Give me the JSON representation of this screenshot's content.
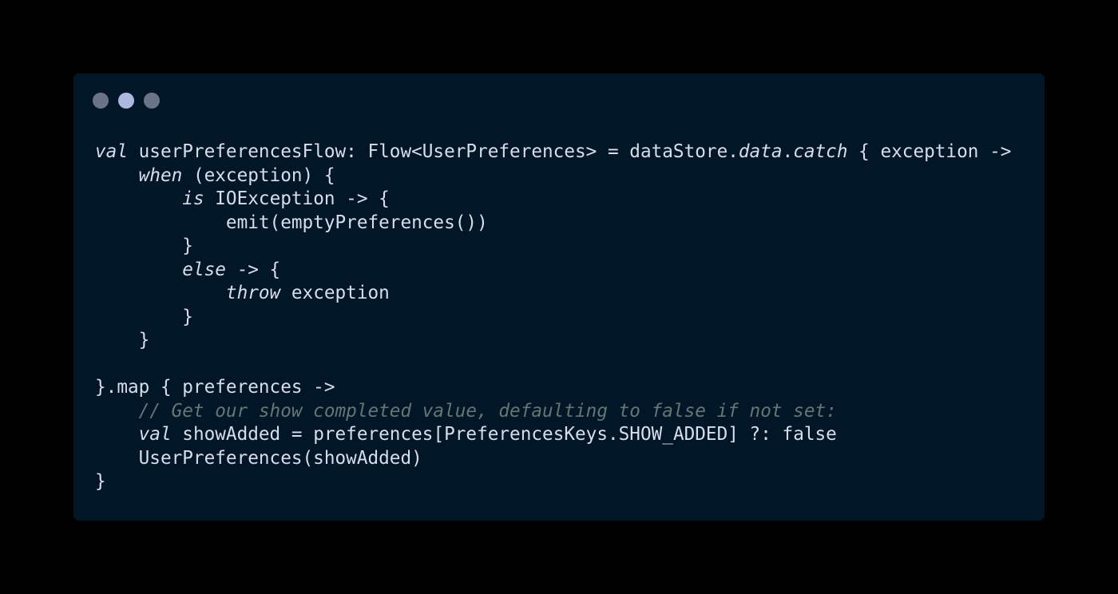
{
  "window": {
    "buttons": [
      {
        "name": "close",
        "color": "#6b7386"
      },
      {
        "name": "minimize",
        "color": "#aeb8de"
      },
      {
        "name": "maximize",
        "color": "#6b7386"
      }
    ]
  },
  "theme": {
    "background": "#011627",
    "text": "#d6deeb",
    "comment": "#637777"
  },
  "code": {
    "lines": [
      [
        {
          "t": "val",
          "s": "kw"
        },
        {
          "t": " userPreferencesFlow: Flow<UserPreferences> = dataStore."
        },
        {
          "t": "data",
          "s": "it"
        },
        {
          "t": "."
        },
        {
          "t": "catch",
          "s": "it"
        },
        {
          "t": " { exception ->"
        }
      ],
      [
        {
          "t": "    "
        },
        {
          "t": "when",
          "s": "kw"
        },
        {
          "t": " (exception) {"
        }
      ],
      [
        {
          "t": "        "
        },
        {
          "t": "is",
          "s": "kw"
        },
        {
          "t": " IOException -> {"
        }
      ],
      [
        {
          "t": "            emit(emptyPreferences())"
        }
      ],
      [
        {
          "t": "        }"
        }
      ],
      [
        {
          "t": "        "
        },
        {
          "t": "else",
          "s": "kw"
        },
        {
          "t": " -> {"
        }
      ],
      [
        {
          "t": "            "
        },
        {
          "t": "throw",
          "s": "kw"
        },
        {
          "t": " exception"
        }
      ],
      [
        {
          "t": "        }"
        }
      ],
      [
        {
          "t": "    }"
        }
      ],
      [
        {
          "t": ""
        }
      ],
      [
        {
          "t": "}.map { preferences ->"
        }
      ],
      [
        {
          "t": "    "
        },
        {
          "t": "// Get our show completed value, defaulting to false if not set:",
          "s": "cm"
        }
      ],
      [
        {
          "t": "    "
        },
        {
          "t": "val",
          "s": "kw"
        },
        {
          "t": " showAdded = preferences[PreferencesKeys.SHOW_ADDED] ?: false"
        }
      ],
      [
        {
          "t": "    UserPreferences(showAdded)"
        }
      ],
      [
        {
          "t": "}"
        }
      ]
    ]
  }
}
